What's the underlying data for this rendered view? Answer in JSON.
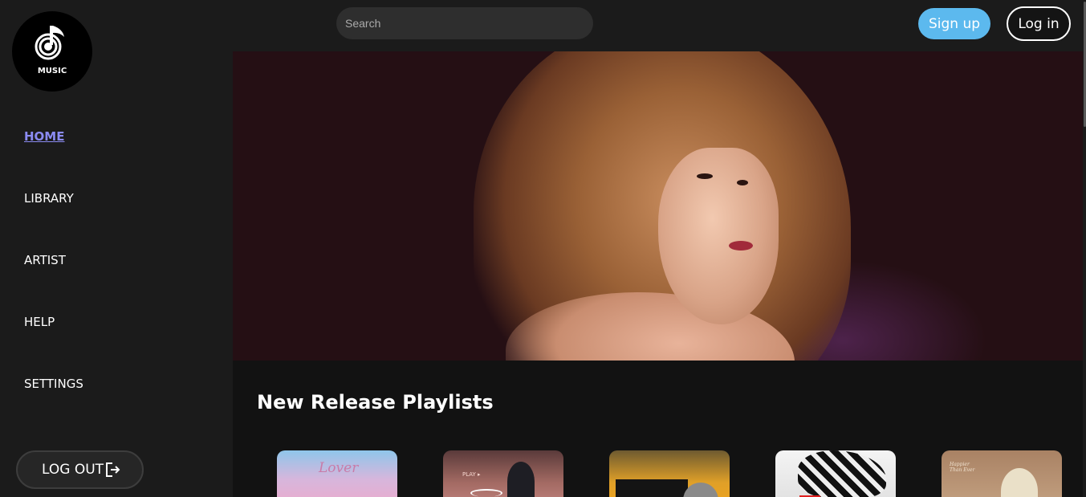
{
  "brand": {
    "logo_text": "MUSIC",
    "logo_icon": "music-note-icon"
  },
  "search": {
    "placeholder": "Search"
  },
  "auth": {
    "signup_label": "Sign up",
    "login_label": "Log in"
  },
  "sidebar": {
    "items": [
      {
        "label": "HOME",
        "active": true
      },
      {
        "label": "LIBRARY",
        "active": false
      },
      {
        "label": "ARTIST",
        "active": false
      },
      {
        "label": "HELP",
        "active": false
      },
      {
        "label": "SETTINGS",
        "active": false
      }
    ],
    "logout_label": "LOG OUT",
    "logout_icon": "logout-icon"
  },
  "section": {
    "title": "New Release Playlists"
  },
  "playlists": [
    {
      "art_text": "Lover"
    },
    {
      "art_text": "PLAY ▸"
    },
    {
      "art_text": ""
    },
    {
      "art_text": ""
    },
    {
      "art_text": "Happier Than Ever"
    }
  ],
  "colors": {
    "accent": "#8b8bf2",
    "signup": "#5cb9ee",
    "background": "#1b1b1b"
  }
}
